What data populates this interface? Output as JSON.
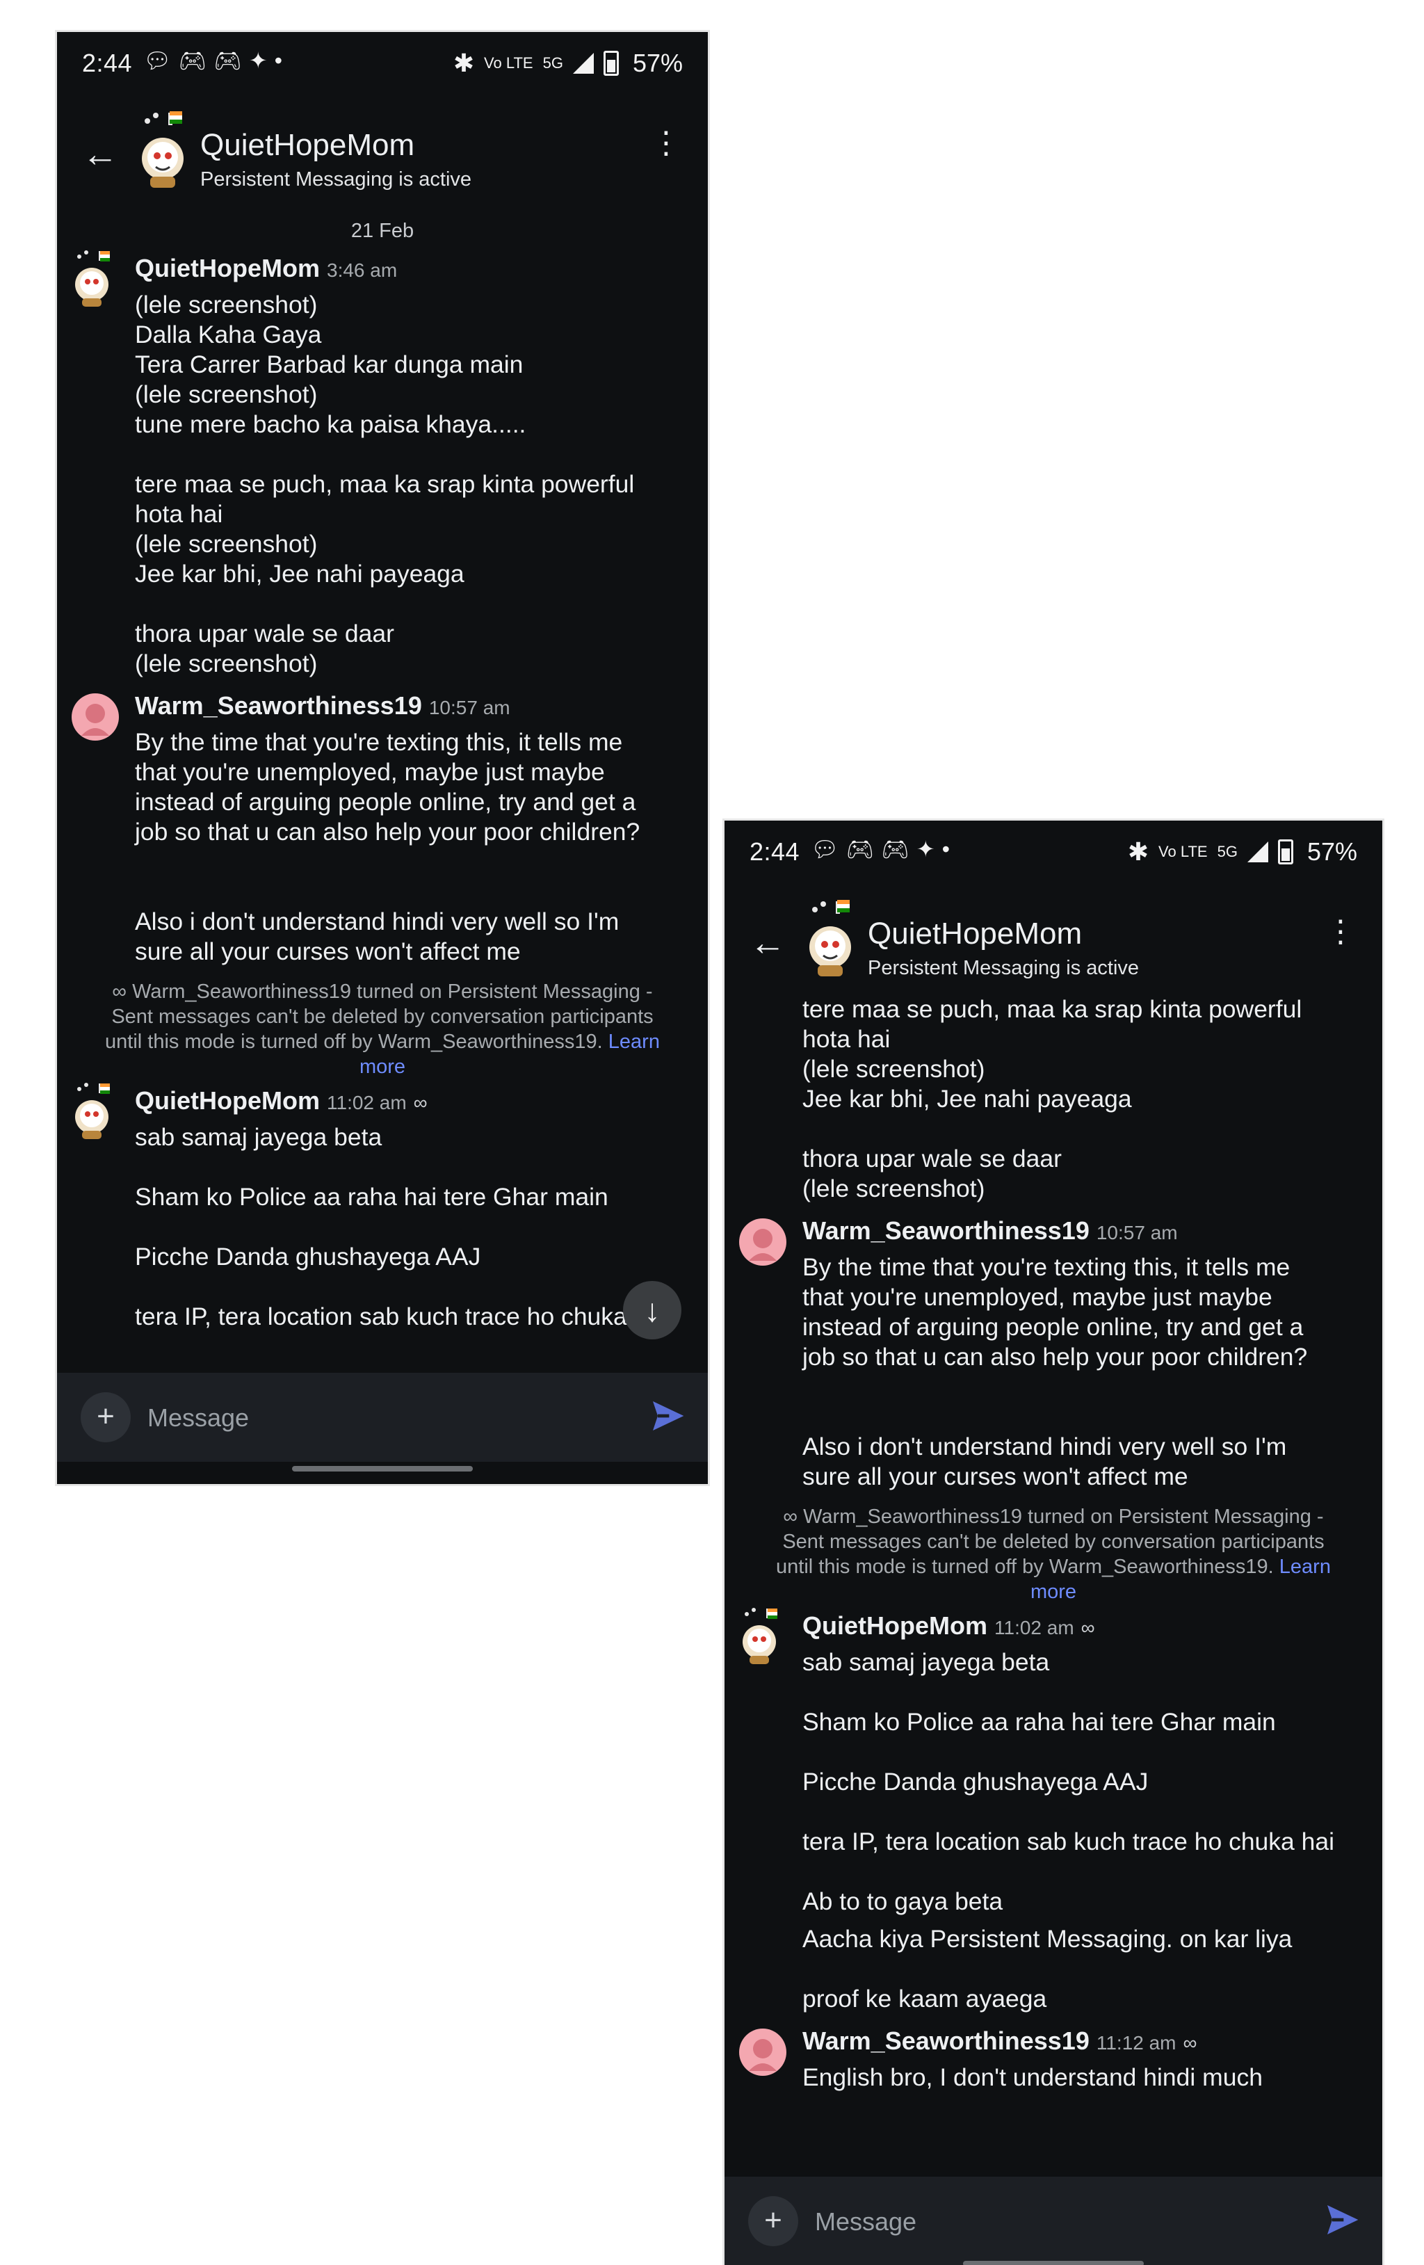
{
  "status_bar": {
    "time": "2:44",
    "notification_icons": [
      "chat-bubble-icon",
      "discord-icon",
      "discord-icon",
      "app-icon",
      "dot-icon"
    ],
    "network_label": "5G",
    "volte_label": "Vo LTE",
    "battery": "57%"
  },
  "header": {
    "title": "QuietHopeMom",
    "subtitle": "Persistent Messaging is active"
  },
  "phone1": {
    "date_separator": "21 Feb",
    "msg_qhm_1": {
      "user": "QuietHopeMom",
      "time": "3:46 am",
      "lines": [
        "(lele screenshot)",
        "Dalla Kaha Gaya",
        "Tera Carrer Barbad kar dunga main",
        "(lele screenshot)",
        "tune mere bacho ka paisa khaya.....",
        "tere maa se puch, maa ka srap kinta powerful",
        "hota hai",
        "(lele screenshot)",
        "Jee kar bhi, Jee nahi payeaga",
        "thora upar wale se daar",
        "(lele screenshot)"
      ]
    },
    "msg_ws_1": {
      "user": "Warm_Seaworthiness19",
      "time": "10:57 am",
      "lines": [
        "By the time that you're texting this, it tells me",
        "that you're unemployed, maybe just maybe",
        "instead of arguing people online, try and get a",
        "job so that u can also help your poor children?",
        "Also i don't understand hindi very well so I'm",
        "sure all your curses won't affect me"
      ]
    },
    "system_note": {
      "symbol": "∞",
      "line1": " Warm_Seaworthiness19 turned on Persistent Messaging -",
      "line2": "Sent messages can't be deleted by conversation participants",
      "line3": "until this mode is turned off by Warm_Seaworthiness19. ",
      "learn": "Learn",
      "more": "more"
    },
    "msg_qhm_2": {
      "user": "QuietHopeMom",
      "time": "11:02 am",
      "infinity": "∞",
      "lines": [
        "sab samaj jayega beta",
        "Sham ko Police aa raha hai tere Ghar main",
        "Picche Danda ghushayega AAJ",
        "tera IP, tera location sab kuch trace ho chuka hai"
      ]
    }
  },
  "phone2": {
    "msg_qhm_partial": {
      "lines": [
        "tere maa se puch, maa ka srap kinta powerful",
        "hota hai",
        "(lele screenshot)",
        "Jee kar bhi, Jee nahi payeaga",
        "thora upar wale se daar",
        "(lele screenshot)"
      ]
    },
    "msg_ws_1": {
      "user": "Warm_Seaworthiness19",
      "time": "10:57 am",
      "lines": [
        "By the time that you're texting this, it tells me",
        "that you're unemployed, maybe just maybe",
        "instead of arguing people online, try and get a",
        "job so that u can also help your poor children?",
        "Also i don't understand hindi very well so I'm",
        "sure all your curses won't affect me"
      ]
    },
    "system_note": {
      "symbol": "∞",
      "line1": " Warm_Seaworthiness19 turned on Persistent Messaging -",
      "line2": "Sent messages can't be deleted by conversation participants",
      "line3": "until this mode is turned off by Warm_Seaworthiness19. ",
      "learn": "Learn",
      "more": "more"
    },
    "msg_qhm_2": {
      "user": "QuietHopeMom",
      "time": "11:02 am",
      "infinity": "∞",
      "lines": [
        "sab samaj jayega beta",
        "Sham ko Police aa raha hai tere Ghar main",
        "Picche Danda ghushayega AAJ",
        "tera IP, tera location sab kuch trace ho chuka hai",
        "Ab to to gaya beta",
        "Aacha kiya Persistent Messaging. on kar liya",
        "proof ke kaam ayaega"
      ]
    },
    "msg_ws_2": {
      "user": "Warm_Seaworthiness19",
      "time": "11:12 am",
      "infinity": "∞",
      "lines": [
        "English bro, I don't understand hindi much"
      ]
    }
  },
  "composer": {
    "placeholder": "Message",
    "plus": "+"
  },
  "colors": {
    "background": "#0e1012",
    "composer": "#1c1f24",
    "link": "#6e8cff",
    "send": "#5a6fd6",
    "avatar_pink": "#f4a7b0"
  }
}
